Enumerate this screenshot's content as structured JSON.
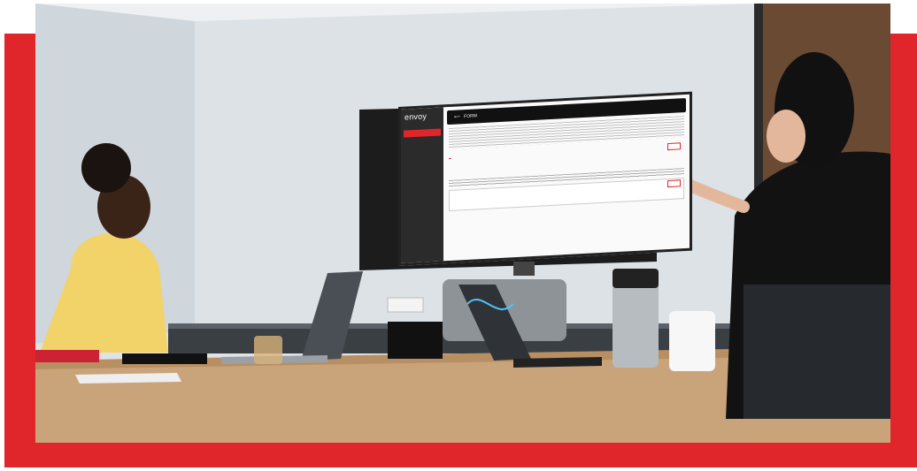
{
  "screen": {
    "logo_main": "envoy",
    "logo_suffix": "",
    "header_title": "FORM",
    "header_arrow": "⟵",
    "nav_items": [
      "",
      "",
      "",
      "",
      "",
      "",
      "",
      "",
      "",
      "",
      "",
      "",
      "",
      "",
      "",
      ""
    ],
    "tabs": [
      "",
      "",
      "",
      "",
      "",
      ""
    ],
    "colors": {
      "brand_red": "#e1262b",
      "sidebar": "#2b2b2b",
      "header": "#111111"
    }
  }
}
